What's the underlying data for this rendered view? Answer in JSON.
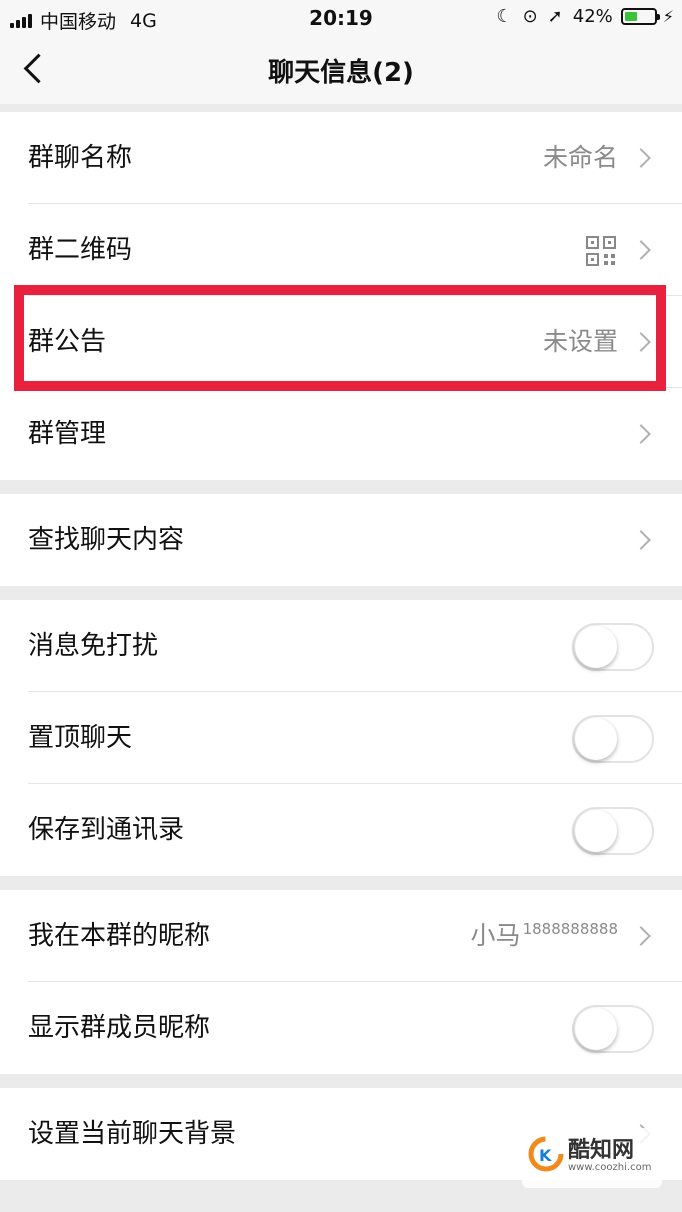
{
  "status_bar": {
    "carrier": "中国移动",
    "network": "4G",
    "time": "20:19",
    "battery": "42%",
    "battery_level": 0.42,
    "icons": [
      "moon-icon",
      "rotation-lock-icon",
      "location-arrow-icon",
      "charging-bolt-icon"
    ]
  },
  "nav": {
    "title": "聊天信息(2)",
    "back_icon": "chevron-left-icon"
  },
  "groups": [
    [
      {
        "label": "群聊名称",
        "value": "未命名"
      },
      {
        "label": "群二维码",
        "icon": "qr-code-icon"
      },
      {
        "label": "群公告",
        "value": "未设置"
      },
      {
        "label": "群管理"
      }
    ],
    [
      {
        "label": "查找聊天内容"
      }
    ],
    [
      {
        "label": "消息免打扰",
        "toggle": false
      },
      {
        "label": "置顶聊天",
        "toggle": false
      },
      {
        "label": "保存到通讯录",
        "toggle": false
      }
    ],
    [
      {
        "label": "我在本群的昵称",
        "value": "小马",
        "value_sup": "1888888888"
      },
      {
        "label": "显示群成员昵称",
        "toggle": false
      }
    ],
    [
      {
        "label": "设置当前聊天背景"
      }
    ]
  ],
  "highlight": {
    "target": "群公告",
    "color": "#e8223e"
  },
  "watermark": {
    "name": "酷知网",
    "url": "www.coozhi.com"
  },
  "colors": {
    "accent_green": "#3cc33c",
    "highlight_red": "#e8223e",
    "value_gray": "#8a8a8a"
  }
}
